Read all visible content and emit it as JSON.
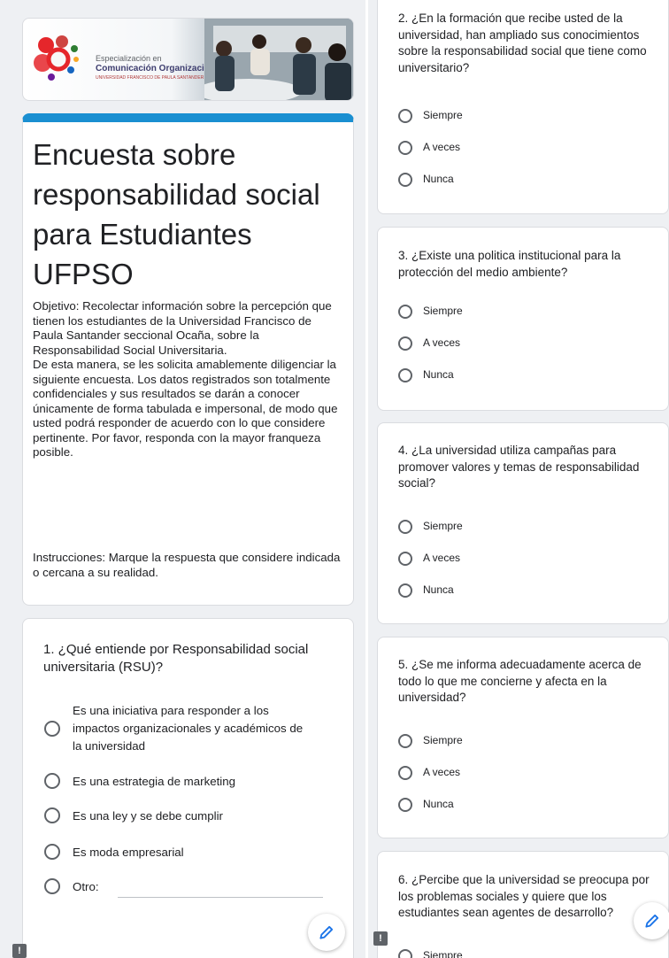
{
  "banner": {
    "logo_line1": "Especialización en",
    "logo_line2": "Comunicación Organizacional",
    "logo_line3": "UNIVERSIDAD FRANCISCO DE PAULA SANTANDER OCAÑA"
  },
  "form": {
    "title": "Encuesta sobre responsabilidad social para Estudiantes UFPSO",
    "description": "Objetivo: Recolectar información sobre la percepción que tienen los estudiantes de la Universidad Francisco de Paula Santander seccional Ocaña, sobre la Responsabilidad Social Universitaria.\nDe esta manera, se les solicita amablemente diligenciar la siguiente encuesta. Los datos registrados son totalmente confidenciales y sus resultados se darán a conocer únicamente de forma tabulada e impersonal, de modo que usted podrá responder de acuerdo con lo que considere pertinente. Por favor, responda con la mayor franqueza posible.",
    "instructions": " Instrucciones: Marque la respuesta que considere indicada o cercana a su realidad."
  },
  "q1": {
    "title": "1. ¿Qué entiende por Responsabilidad social universitaria (RSU)?",
    "options": [
      "Es una iniciativa para responder a los impactos organizacionales y académicos de la universidad",
      "Es una estrategia de marketing",
      "Es una ley y se debe cumplir",
      "Es moda empresarial",
      "Otro:"
    ]
  },
  "q2": {
    "title": "2. ¿En la formación que recibe usted de la universidad, han ampliado sus conocimientos sobre la responsabilidad social que tiene como universitario?",
    "options": [
      "Siempre",
      "A veces",
      "Nunca"
    ]
  },
  "q3": {
    "title": "3. ¿Existe una politica institucional para la protección del medio ambiente?",
    "options": [
      "Siempre",
      "A veces",
      "Nunca"
    ]
  },
  "q4": {
    "title": "4. ¿La universidad utiliza campañas para promover valores y temas de responsabilidad social?",
    "options": [
      "Siempre",
      "A veces",
      "Nunca"
    ]
  },
  "q5": {
    "title": "5. ¿Se me informa adecuadamente acerca de todo lo que me concierne y afecta en la universidad?",
    "options": [
      "Siempre",
      "A veces",
      "Nunca"
    ]
  },
  "q6": {
    "title": "6. ¿Percibe que la universidad se preocupa por los problemas sociales y quiere que los estudiantes sean agentes de desarrollo?",
    "options": [
      "Siempre"
    ]
  },
  "icons": {
    "edit": "pencil-icon",
    "feedback": "report-issue-icon"
  },
  "colors": {
    "header_accent": "#1a8fd1",
    "background": "#eef0f3"
  }
}
